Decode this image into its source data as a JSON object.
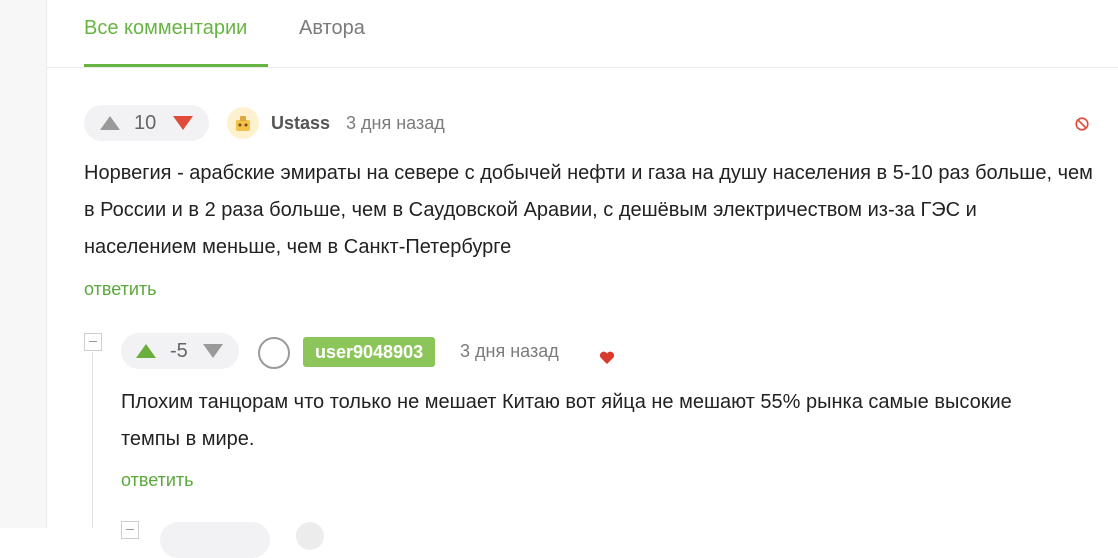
{
  "tabs": [
    {
      "label": "Все комментарии",
      "active": true
    },
    {
      "label": "Автора",
      "active": false
    }
  ],
  "comments": [
    {
      "score": "10",
      "username": "Ustass",
      "time": "3 дня назад",
      "text": "Норвегия - арабские эмираты на севере с добычей нефти и газа на душу населения в 5-10 раз больше, чем в России и в 2 раза больше, чем в Саудовской Аравии, с дешёвым электричеством из-за ГЭС и населением меньше, чем в Санкт-Петербурге",
      "reply_label": "ответить",
      "vote_state": "downvoted"
    },
    {
      "score": "-5",
      "username": "user9048903",
      "time": "3 дня назад",
      "text": "Плохим танцорам что только не мешает Китаю вот яйца не мешают 55% рынка самые высокие темпы в мире.",
      "reply_label": "ответить",
      "vote_state": "upvoted"
    }
  ],
  "colors": {
    "accent": "#67b443",
    "downvote": "#e04b3a",
    "upvote": "#6aaf3c",
    "heart": "#d93a2b",
    "badge": "#8cc65b"
  },
  "icons": [
    "arrow-up-icon",
    "arrow-down-icon",
    "avatar",
    "block-icon",
    "heart-icon",
    "collapse-icon"
  ]
}
